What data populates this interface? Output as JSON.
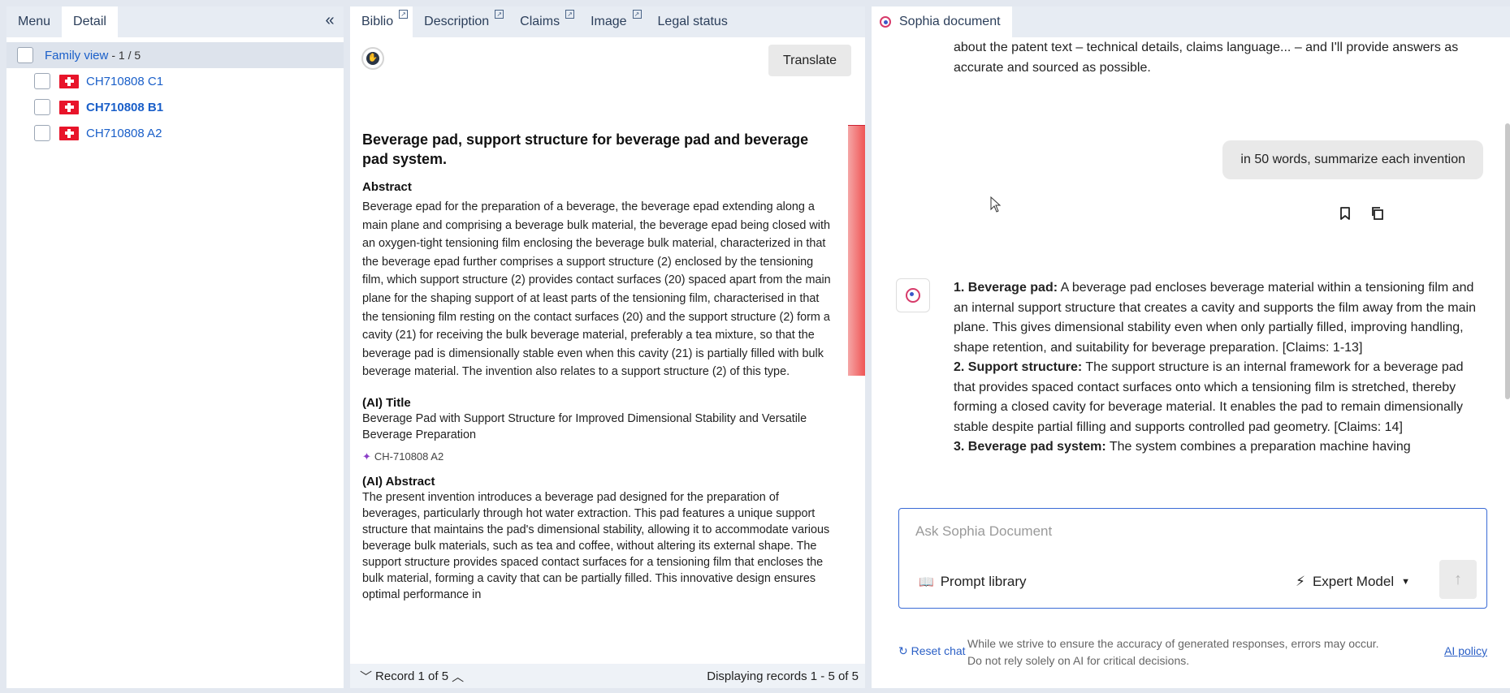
{
  "left_panel": {
    "tabs": [
      "Menu",
      "Detail"
    ],
    "collapse_glyph": "«",
    "family": {
      "title": "Family view",
      "count": "- 1 / 5"
    },
    "members": [
      "CH710808 C1",
      "CH710808 B1",
      "CH710808 A2"
    ]
  },
  "middle_panel": {
    "tabs": [
      "Biblio",
      "Description",
      "Claims",
      "Image",
      "Legal status"
    ],
    "translate_label": "Translate",
    "title": "Beverage pad, support structure for beverage pad and beverage pad system.",
    "abstract_heading": "Abstract",
    "abstract_text": "Beverage epad for the preparation of a beverage, the beverage epad extending along a main plane and comprising a beverage bulk material, the beverage epad being closed with an oxygen-tight tensioning film enclosing the beverage bulk material, characterized in that the beverage epad further comprises a support structure (2) enclosed by the tensioning film, which support structure (2) provides contact surfaces (20) spaced apart from the main plane for the shaping support of at least parts of the tensioning film, characterised in that the tensioning film resting on the contact surfaces (20) and the support structure (2) form a cavity (21) for receiving the bulk beverage material, preferably a tea mixture, so that the beverage pad is dimensionally stable even when this cavity (21) is partially filled with bulk beverage material. The invention also relates to a support structure (2) of this type.",
    "ai_title_heading": "(AI) Title",
    "ai_title_text": "Beverage Pad with Support Structure for Improved Dimensional Stability and Versatile Beverage Preparation",
    "ai_source": "CH-710808 A2",
    "ai_abstract_heading": "(AI) Abstract",
    "ai_abstract_text": "The present invention introduces a beverage pad designed for the preparation of beverages, particularly through hot water extraction. This pad features a unique support structure that maintains the pad's dimensional stability, allowing it to accommodate various beverage bulk materials, such as tea and coffee, without altering its external shape. The support structure provides spaced contact surfaces for a tensioning film that encloses the bulk material, forming a cavity that can be partially filled. This innovative design ensures optimal performance in",
    "record_label": "Record 1 of 5",
    "displaying_label": "Displaying records 1 - 5 of 5"
  },
  "right_panel": {
    "tab_label": "Sophia document",
    "intro_text": "about the patent text – technical details, claims language... – and I'll provide answers as accurate and sourced as possible.",
    "user_message": "in 50 words, summarize each invention",
    "answer": [
      {
        "label": "1. Beverage pad:",
        "text": " A beverage pad encloses beverage material within a tensioning film and an internal support structure that creates a cavity and supports the film away from the main plane. This gives dimensional stability even when only partially filled, improving handling, shape retention, and suitability for beverage preparation. [Claims: 1-13]"
      },
      {
        "label": "2. Support structure:",
        "text": " The support structure is an internal framework for a beverage pad that provides spaced contact surfaces onto which a tensioning film is stretched, thereby forming a closed cavity for beverage material. It enables the pad to remain dimensionally stable despite partial filling and supports controlled pad geometry. [Claims: 14]"
      },
      {
        "label": "3. Beverage pad system:",
        "text": " The system combines a preparation machine having"
      }
    ],
    "input_placeholder": "Ask Sophia Document",
    "prompt_library_label": "Prompt library",
    "model_label": "Expert Model",
    "reset_label": "Reset chat",
    "disclaimer": "While we strive to ensure the accuracy of generated responses, errors may occur. Do not rely solely on AI for critical decisions.",
    "policy_label": "AI policy"
  }
}
